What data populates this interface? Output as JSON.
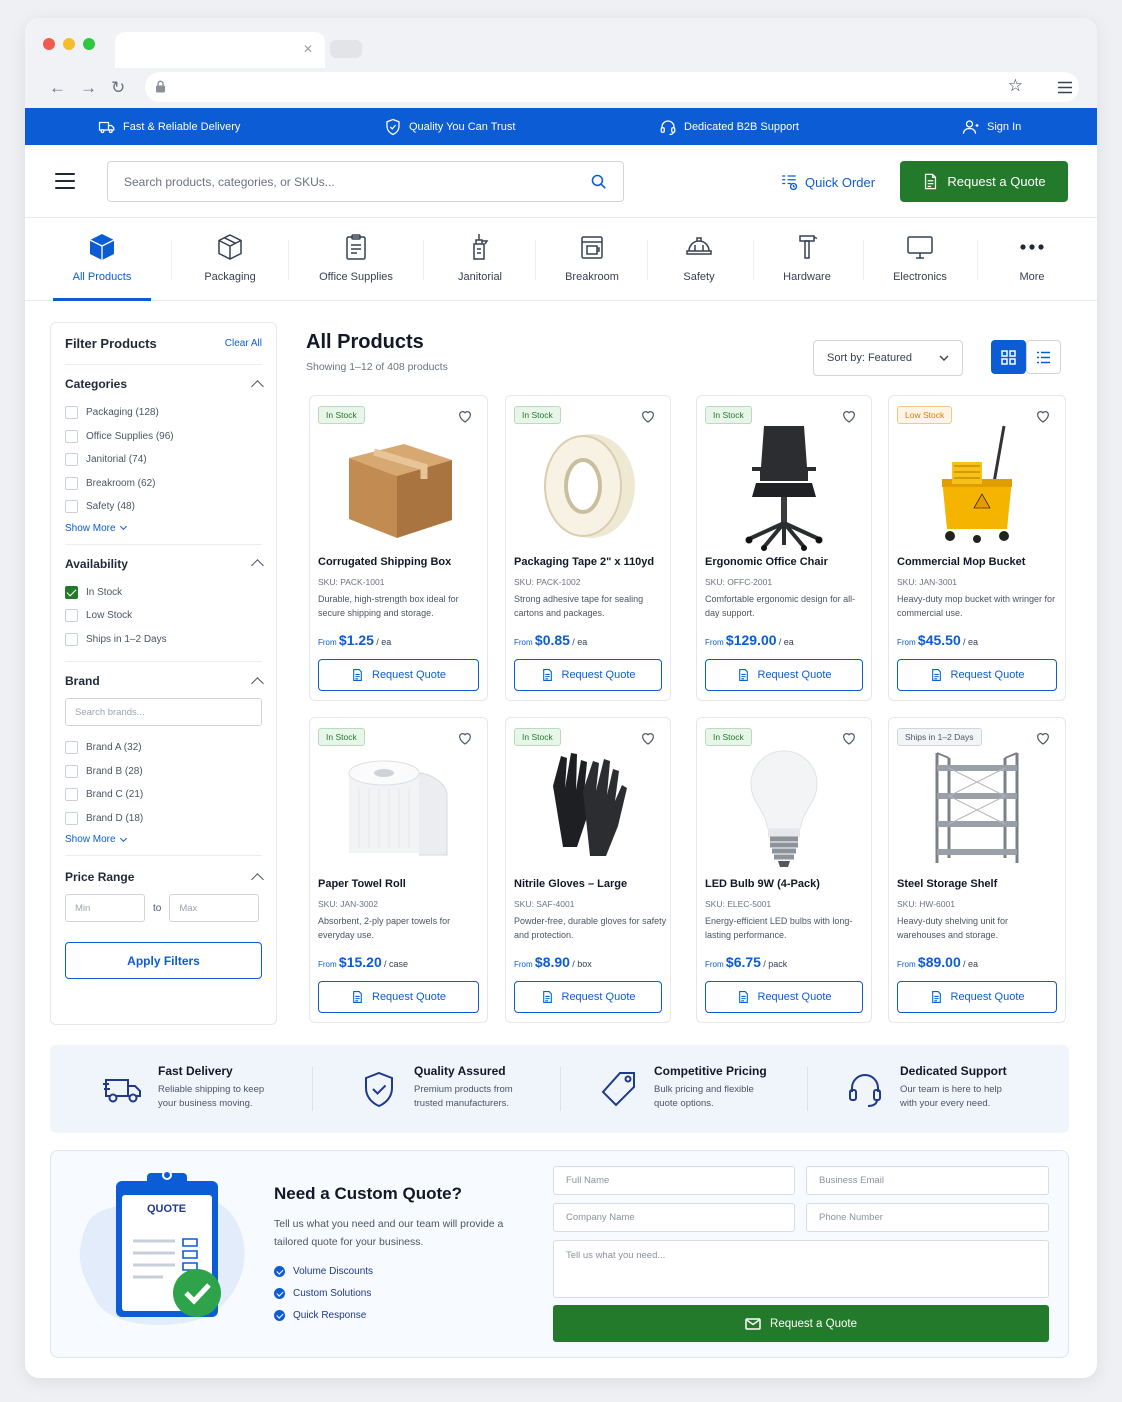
{
  "promo": [
    {
      "label": "Fast & Reliable Delivery",
      "icon": "truck-icon"
    },
    {
      "label": "Quality You Can Trust",
      "icon": "shield-check-icon"
    },
    {
      "label": "Dedicated B2B Support",
      "icon": "headset-icon"
    },
    {
      "label": "Sign In",
      "icon": "user-icon"
    }
  ],
  "header": {
    "search_placeholder": "Search products, categories, or SKUs...",
    "quick_order": "Quick Order",
    "request_quote": "Request a Quote"
  },
  "categories": [
    {
      "label": "All Products",
      "icon": "cube-icon",
      "active": true
    },
    {
      "label": "Packaging",
      "icon": "package-icon"
    },
    {
      "label": "Office Supplies",
      "icon": "clipboard-icon"
    },
    {
      "label": "Janitorial",
      "icon": "cleaning-spray-icon"
    },
    {
      "label": "Breakroom",
      "icon": "coffee-machine-icon"
    },
    {
      "label": "Safety",
      "icon": "hard-hat-icon"
    },
    {
      "label": "Hardware",
      "icon": "hammer-icon"
    },
    {
      "label": "Electronics",
      "icon": "monitor-icon"
    },
    {
      "label": "More",
      "icon": "more-icon"
    }
  ],
  "filters": {
    "title": "Filter Products",
    "clear": "Clear All",
    "categories_title": "Categories",
    "categories": [
      "Packaging (128)",
      "Office Supplies (96)",
      "Janitorial (74)",
      "Breakroom (62)",
      "Safety (48)"
    ],
    "show_more": "Show More",
    "availability_title": "Availability",
    "availability": [
      "In Stock",
      "Low Stock",
      "Ships in 1–2 Days"
    ],
    "brand_title": "Brand",
    "brand_search": "Search brands...",
    "brands": [
      "Brand A (32)",
      "Brand B (28)",
      "Brand C (21)",
      "Brand D (18)"
    ],
    "price_title": "Price Range",
    "min": "Min",
    "to": "to",
    "max": "Max",
    "apply": "Apply Filters"
  },
  "main": {
    "title": "All Products",
    "showing": "Showing 1–12 of 408 products",
    "sort": "Sort by: Featured"
  },
  "products": [
    {
      "badge": "In Stock",
      "name": "Corrugated Shipping Box",
      "sku": "SKU: PACK-1001",
      "desc": "Durable, high-strength box ideal for secure shipping and storage.",
      "from": "From",
      "price": "$1.25",
      "unit": "/ ea",
      "btn": "Request Quote"
    },
    {
      "badge": "In Stock",
      "name": "Packaging Tape 2\" x 110yd",
      "sku": "SKU: PACK-1002",
      "desc": "Strong adhesive tape for sealing cartons and packages.",
      "from": "From",
      "price": "$0.85",
      "unit": "/ ea",
      "btn": "Request Quote"
    },
    {
      "badge": "In Stock",
      "name": "Ergonomic Office Chair",
      "sku": "SKU: OFFC-2001",
      "desc": "Comfortable ergonomic design for all-day support.",
      "from": "From",
      "price": "$129.00",
      "unit": "/ ea",
      "btn": "Request Quote"
    },
    {
      "badge": "Low Stock",
      "name": "Commercial Mop Bucket",
      "sku": "SKU: JAN-3001",
      "desc": "Heavy-duty mop bucket with wringer for commercial use.",
      "from": "From",
      "price": "$45.50",
      "unit": "/ ea",
      "btn": "Request Quote"
    },
    {
      "badge": "In Stock",
      "name": "Paper Towel Roll",
      "sku": "SKU: JAN-3002",
      "desc": "Absorbent, 2-ply paper towels for everyday use.",
      "from": "From",
      "price": "$15.20",
      "unit": "/ case",
      "btn": "Request Quote"
    },
    {
      "badge": "In Stock",
      "name": "Nitrile Gloves – Large",
      "sku": "SKU: SAF-4001",
      "desc": "Powder-free, durable gloves for safety and protection.",
      "from": "From",
      "price": "$8.90",
      "unit": "/ box",
      "btn": "Request Quote"
    },
    {
      "badge": "In Stock",
      "name": "LED Bulb 9W (4-Pack)",
      "sku": "SKU: ELEC-5001",
      "desc": "Energy-efficient LED bulbs with long-lasting performance.",
      "from": "From",
      "price": "$6.75",
      "unit": "/ pack",
      "btn": "Request Quote"
    },
    {
      "badge": "Ships in 1–2 Days",
      "name": "Steel Storage Shelf",
      "sku": "SKU: HW-6001",
      "desc": "Heavy-duty shelving unit for warehouses and storage.",
      "from": "From",
      "price": "$89.00",
      "unit": "/ ea",
      "btn": "Request Quote"
    }
  ],
  "features": [
    {
      "title": "Fast Delivery",
      "text": "Reliable shipping to keep your business moving.",
      "icon": "truck-icon"
    },
    {
      "title": "Quality Assured",
      "text": "Premium products from trusted manufacturers.",
      "icon": "shield-check-icon"
    },
    {
      "title": "Competitive Pricing",
      "text": "Bulk pricing and flexible quote options.",
      "icon": "price-tag-icon"
    },
    {
      "title": "Dedicated Support",
      "text": "Our team is here to help with your every need.",
      "icon": "headset-icon"
    }
  ],
  "quote": {
    "clipboard_label": "QUOTE",
    "title": "Need a Custom Quote?",
    "text": "Tell us what you need and our team will provide a tailored quote for your business.",
    "bullets": [
      "Volume Discounts",
      "Custom Solutions",
      "Quick Response"
    ],
    "full_name": "Full Name",
    "email": "Business Email",
    "company": "Company Name",
    "phone": "Phone Number",
    "message": "Tell us what you need...",
    "submit": "Request a Quote"
  },
  "colors": {
    "brand_blue": "#0b5cd5",
    "action_green": "#237a2b",
    "low_stock": "#e07b00"
  }
}
